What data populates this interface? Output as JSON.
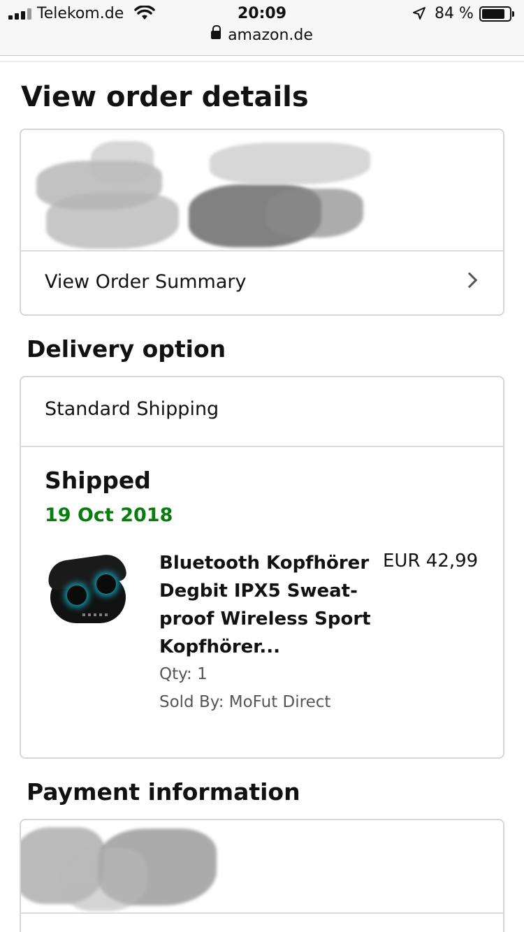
{
  "status_bar": {
    "carrier": "Telekom.de",
    "time": "20:09",
    "battery_percent": "84 %",
    "battery_level": 0.84
  },
  "browser": {
    "url": "amazon.de"
  },
  "page": {
    "title": "View order details"
  },
  "order_card": {
    "summary_link": "View Order Summary"
  },
  "delivery": {
    "heading": "Delivery option",
    "method": "Standard Shipping",
    "status": "Shipped",
    "date": "19 Oct 2018",
    "date_color": "#067d0d",
    "item": {
      "title": "Bluetooth Kopfhörer Degbit IPX5 Sweat-proof Wireless Sport Kopfhörer...",
      "price": "EUR 42,99",
      "qty": "Qty: 1",
      "sold_by": "Sold By: MoFut Direct",
      "image_icon": "earbuds-product-image"
    }
  },
  "payment": {
    "heading": "Payment information"
  },
  "icons": {
    "signal": "signal-bars-icon",
    "wifi": "wifi-icon",
    "location": "location-arrow-icon",
    "battery": "battery-icon",
    "lock": "lock-icon",
    "chevron": "chevron-right-icon"
  }
}
